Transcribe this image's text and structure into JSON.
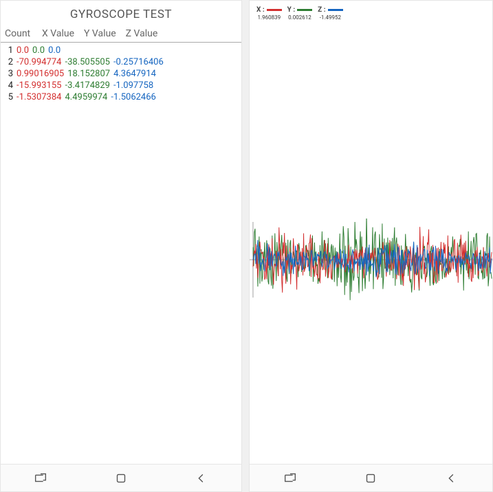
{
  "left": {
    "title": "GYROSCOPE TEST",
    "headers": {
      "count": "Count",
      "x": "X Value",
      "y": "Y Value",
      "z": "Z Value"
    },
    "rows": [
      {
        "count": "1",
        "x": "0.0",
        "y": "0.0",
        "z": "0.0"
      },
      {
        "count": "2",
        "x": "-70.994774",
        "y": "-38.505505",
        "z": "-0.25716406"
      },
      {
        "count": "3",
        "x": "0.99016905",
        "y": "18.152807",
        "z": "4.3647914"
      },
      {
        "count": "4",
        "x": "-15.993155",
        "y": "-3.4174829",
        "z": "-1.097758"
      },
      {
        "count": "5",
        "x": "-1.5307384",
        "y": "4.4959974",
        "z": "-1.5062466"
      }
    ]
  },
  "right": {
    "legend": {
      "x": {
        "letter": "X :",
        "value": "1.960839"
      },
      "y": {
        "letter": "Y :",
        "value": "0.002612"
      },
      "z": {
        "letter": "Z :",
        "value": "-1.49952"
      }
    }
  },
  "chart_data": {
    "type": "line",
    "title": "",
    "xlabel": "",
    "ylabel": "",
    "ylim": [
      -50,
      50
    ],
    "x": "time-index (0..N)",
    "series": [
      {
        "name": "X",
        "color": "#d32f2f",
        "values_described": "noisy gyroscope X signal oscillating roughly between -40 and 40 with bursty segments"
      },
      {
        "name": "Y",
        "color": "#2e7d32",
        "values_described": "noisy gyroscope Y signal oscillating roughly between -45 and 45, highest amplitude of the three"
      },
      {
        "name": "Z",
        "color": "#1565c0",
        "values_described": "noisy gyroscope Z signal smaller amplitude roughly -20 to 20"
      }
    ],
    "note": "exact per-sample values are not readable from the screenshot; waveform is dense quasi-random sensor noise"
  },
  "nav": {
    "recent": "recent-apps-icon",
    "home": "home-icon",
    "back": "back-icon"
  }
}
